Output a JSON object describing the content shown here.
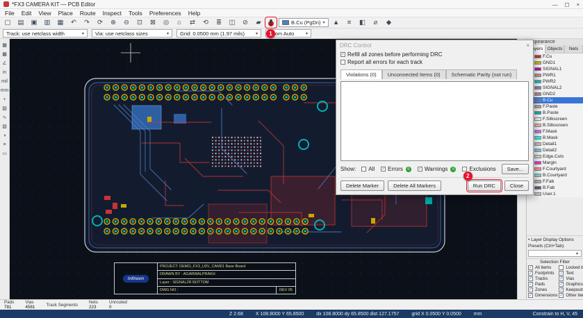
{
  "ui": {
    "caret": "▾",
    "bullet": "•"
  },
  "annotations": {
    "step1": "1",
    "step2": "2",
    "color": "#E8112D"
  },
  "window": {
    "title": "*FX3 CAMERA KIT — PCB Editor",
    "minimize": "—",
    "maximize": "▢",
    "close": "×"
  },
  "menubar": {
    "items": [
      "File",
      "Edit",
      "View",
      "Place",
      "Route",
      "Inspect",
      "Tools",
      "Preferences",
      "Help"
    ]
  },
  "toolbar_main": {
    "icons_before": [
      {
        "name": "new-board-icon",
        "glyph": "▢"
      },
      {
        "name": "open-board-icon",
        "glyph": "▤"
      },
      {
        "name": "save-icon",
        "glyph": "▣"
      },
      {
        "name": "print-icon",
        "glyph": "▥"
      },
      {
        "name": "plot-icon",
        "glyph": "▦"
      },
      {
        "name": "undo-icon",
        "glyph": "↶"
      },
      {
        "name": "redo-icon",
        "glyph": "↷"
      },
      {
        "name": "refresh-icon",
        "glyph": "⟳"
      },
      {
        "name": "zoom-in-icon",
        "glyph": "⊕"
      },
      {
        "name": "zoom-out-icon",
        "glyph": "⊖"
      },
      {
        "name": "zoom-fit-icon",
        "glyph": "⊡"
      },
      {
        "name": "zoom-selection-icon",
        "glyph": "⊠"
      },
      {
        "name": "find-icon",
        "glyph": "◎"
      },
      {
        "name": "footprint-editor-icon",
        "glyph": "⌂"
      },
      {
        "name": "update-pcb-icon",
        "glyph": "⇄"
      },
      {
        "name": "rotate-icon",
        "glyph": "⟲"
      },
      {
        "name": "properties-icon",
        "glyph": "≣"
      },
      {
        "name": "net-inspector-icon",
        "glyph": "◫"
      },
      {
        "name": "clean-tracks-icon",
        "glyph": "⊘"
      },
      {
        "name": "fill-zones-icon",
        "glyph": "▰"
      }
    ],
    "layer_selector": {
      "value": "B.Cu (PgDn)",
      "swatch": "#4D7FC4"
    },
    "icons_after": [
      {
        "name": "3d-viewer-icon",
        "glyph": "▲"
      },
      {
        "name": "scripting-console-icon",
        "glyph": "≡"
      },
      {
        "name": "layer-manager-icon",
        "glyph": "◧"
      },
      {
        "name": "measure-icon",
        "glyph": "⌀"
      },
      {
        "name": "plugins-icon",
        "glyph": "◆"
      }
    ]
  },
  "toolbar_secondary": {
    "track": "Track: use netclass width",
    "via": "Via: use netclass sizes",
    "grid": "Grid: 0.0500 mm (1.97 mils)",
    "zoom": "Zoom Auto"
  },
  "left_toolbar": {
    "icons": [
      {
        "name": "grid-visibility-icon",
        "glyph": "▦"
      },
      {
        "name": "grid-dots-icon",
        "glyph": "▩"
      },
      {
        "name": "polar-coordinates-icon",
        "glyph": "∠"
      },
      {
        "name": "units-inches-icon",
        "glyph": "in"
      },
      {
        "name": "units-mils-icon",
        "glyph": "mil"
      },
      {
        "name": "units-mm-icon",
        "glyph": "mm"
      },
      {
        "name": "cursor-shape-icon",
        "glyph": "+"
      },
      {
        "name": "ratsnest-icon",
        "glyph": "▨"
      },
      {
        "name": "curved-ratsnest-icon",
        "glyph": "∿"
      },
      {
        "name": "zone-display-icon",
        "glyph": "▧"
      },
      {
        "name": "high-contrast-icon",
        "glyph": "◑"
      },
      {
        "name": "net-names-icon",
        "glyph": "≡"
      },
      {
        "name": "drawing-sheet-icon",
        "glyph": "▭"
      }
    ]
  },
  "right_toolbar": {
    "icons": [
      {
        "name": "select-tool-icon",
        "glyph": "↖"
      },
      {
        "name": "highlight-net-icon",
        "glyph": "★"
      },
      {
        "name": "drag-tool-icon",
        "glyph": "⇕"
      },
      {
        "name": "route-tracks-icon",
        "glyph": "∿"
      },
      {
        "name": "route-diff-pair-icon",
        "glyph": "≈"
      },
      {
        "name": "place-via-icon",
        "glyph": "◉"
      },
      {
        "name": "draw-zone-icon",
        "glyph": "▰"
      },
      {
        "name": "rule-area-icon",
        "glyph": "▱"
      },
      {
        "name": "draw-line-icon",
        "glyph": "╱"
      },
      {
        "name": "draw-arc-icon",
        "glyph": "◠"
      },
      {
        "name": "draw-circle-icon",
        "glyph": "○"
      },
      {
        "name": "add-text-icon",
        "glyph": "T"
      },
      {
        "name": "dimension-icon",
        "glyph": "↔"
      },
      {
        "name": "delete-tool-icon",
        "glyph": "×"
      },
      {
        "name": "measure-tool-icon",
        "glyph": "⌀"
      }
    ]
  },
  "drc_dialog": {
    "title": "DRC Control",
    "close_glyph": "×",
    "options": [
      {
        "label": "Refill all zones before performing DRC",
        "checked": true
      },
      {
        "label": "Report all errors for each track",
        "checked": false
      }
    ],
    "tabs": [
      {
        "label": "Violations (0)",
        "active": true
      },
      {
        "label": "Unconnected Items (0)",
        "active": false
      },
      {
        "label": "Schematic Parity (not run)",
        "active": false
      }
    ],
    "show_label": "Show:",
    "show_filters": [
      {
        "label": "All",
        "checked": false
      },
      {
        "label": "Errors",
        "checked": true,
        "badge": "0"
      },
      {
        "label": "Warnings",
        "checked": true,
        "badge": "0"
      },
      {
        "label": "Exclusions",
        "checked": false
      }
    ],
    "save_button": "Save...",
    "delete_marker_button": "Delete Marker",
    "delete_all_button": "Delete All Markers",
    "run_drc_button": "Run DRC",
    "close_button": "Close"
  },
  "appearance_panel": {
    "title": "Appearance",
    "tabs": [
      {
        "label": "Layers",
        "active": true
      },
      {
        "label": "Objects",
        "active": false
      },
      {
        "label": "Nets",
        "active": false
      }
    ],
    "layers": [
      {
        "name": "F.Cu",
        "color": "#C83434",
        "selected": false
      },
      {
        "name": "GND1",
        "color": "#BFBF00",
        "selected": false
      },
      {
        "name": "SIGNAL1",
        "color": "#C200C2",
        "selected": false
      },
      {
        "name": "PWR1",
        "color": "#B49680",
        "selected": false
      },
      {
        "name": "PWR2",
        "color": "#00C2C2",
        "selected": false
      },
      {
        "name": "SIGNAL2",
        "color": "#8080C2",
        "selected": false
      },
      {
        "name": "GND2",
        "color": "#C28080",
        "selected": false
      },
      {
        "name": "B.Cu",
        "color": "#4D7FC4",
        "selected": true
      },
      {
        "name": "F.Paste",
        "color": "#B4A098",
        "selected": false
      },
      {
        "name": "B.Paste",
        "color": "#00B2B2",
        "selected": false
      },
      {
        "name": "F.Silkscreen",
        "color": "#F3ECE8",
        "selected": false
      },
      {
        "name": "B.Silkscreen",
        "color": "#E8B2A7",
        "selected": false
      },
      {
        "name": "F.Mask",
        "color": "#D864FF",
        "selected": false
      },
      {
        "name": "B.Mask",
        "color": "#02FFEE",
        "selected": false
      },
      {
        "name": "Detail1",
        "color": "#C2C2C2",
        "selected": false
      },
      {
        "name": "Detail2",
        "color": "#7AC0F4",
        "selected": false
      },
      {
        "name": "Edge.Cuts",
        "color": "#D0D2CD",
        "selected": false
      },
      {
        "name": "Margin",
        "color": "#FF26E2",
        "selected": false
      },
      {
        "name": "F.Courtyard",
        "color": "#FF8C83",
        "selected": false
      },
      {
        "name": "B.Courtyard",
        "color": "#73DBCA",
        "selected": false
      },
      {
        "name": "F.Fab",
        "color": "#AFAFAF",
        "selected": false
      },
      {
        "name": "B.Fab",
        "color": "#585D84",
        "selected": false
      },
      {
        "name": "User.1",
        "color": "#C2C2C2",
        "selected": false
      }
    ],
    "sections": {
      "layer_display_options": "Layer Display Options",
      "presets_label": "Presets (Ctrl+Tab):",
      "presets_value": "",
      "selection_filter_title": "Selection Filter"
    },
    "selection_filter_left": [
      {
        "label": "All items",
        "checked": true
      },
      {
        "label": "Footprints",
        "checked": true
      },
      {
        "label": "Tracks",
        "checked": true
      },
      {
        "label": "Pads",
        "checked": true
      },
      {
        "label": "Zones",
        "checked": true
      },
      {
        "label": "Dimensions",
        "checked": true
      }
    ],
    "selection_filter_right": [
      {
        "label": "Locked items",
        "checked": false
      },
      {
        "label": "Text",
        "checked": true
      },
      {
        "label": "Vias",
        "checked": true
      },
      {
        "label": "Graphics",
        "checked": true
      },
      {
        "label": "Keepouts",
        "checked": true
      },
      {
        "label": "Other items",
        "checked": true
      }
    ]
  },
  "canvas": {
    "title_block": {
      "logo_text": "Infineon",
      "project": "PROJECT: DEMO_FX3_U3V_CAM01 Base Board",
      "drawn_by": "DRAWN BY : AGARWALPRAKH",
      "layer_row": "Layer : SIGNAL2R BOTTOM",
      "dwg_no": "DWG NO :",
      "rev": "REV 05"
    },
    "colors": {
      "background": "#0C1018",
      "board_outline": "#C8CCD4",
      "copper_top": "#C83434",
      "copper_bottom": "#4D7FC4",
      "pad_ring": "#C8A800",
      "pad_hole": "#00B3B3"
    }
  },
  "stats": {
    "items": [
      {
        "label": "Pads",
        "value": "781"
      },
      {
        "label": "Vias",
        "value": "4581"
      },
      {
        "label": "Track Segments",
        "value": ""
      },
      {
        "label": "Nets",
        "value": "223"
      },
      {
        "label": "Unrouted",
        "value": "0"
      }
    ]
  },
  "statusbar": {
    "zoom": "Z 2.68",
    "cursor": "X 108.8000 Y 65.8500",
    "delta": "dx 108.8000 dy 65.8500 dist 127.1757",
    "grid": "grid X 0.0500 Y 0.0500",
    "units": "mm",
    "constrain": "Constrain to H, V, 45"
  }
}
